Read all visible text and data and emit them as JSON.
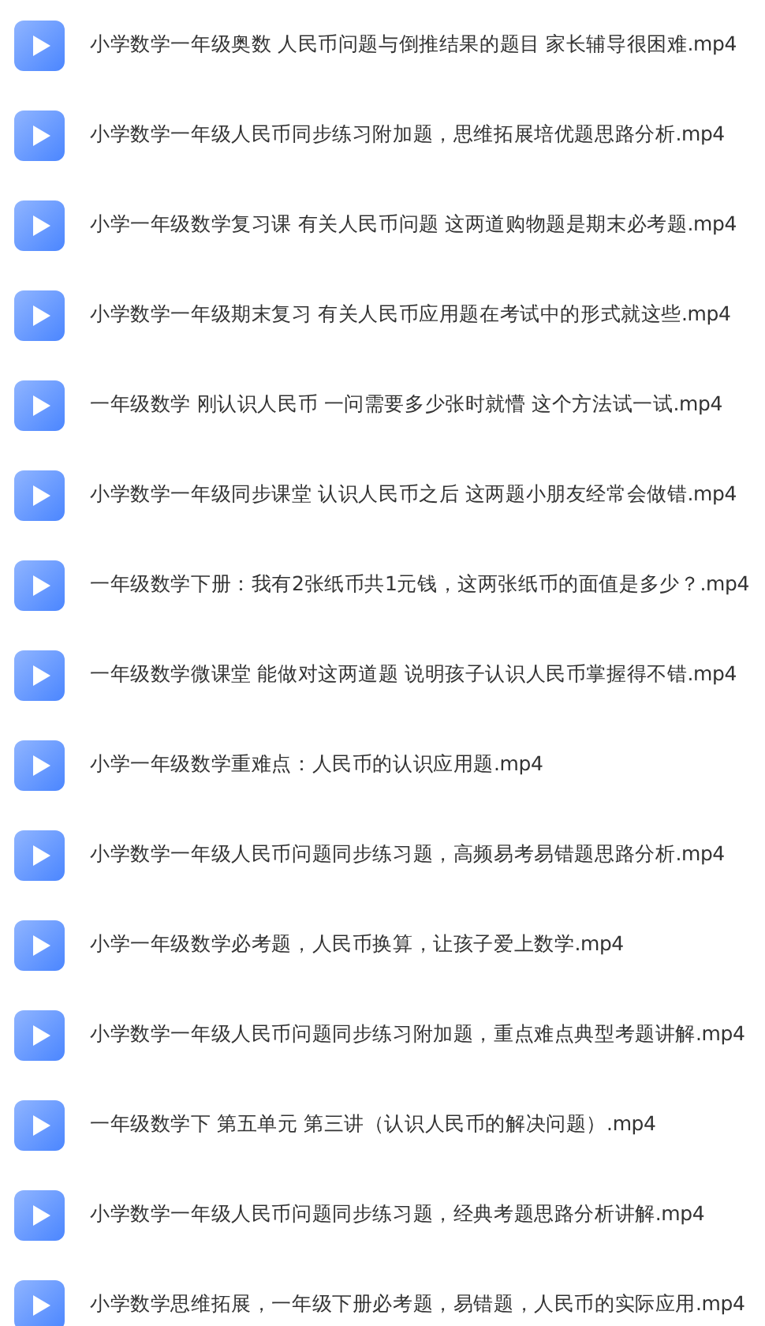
{
  "files": [
    {
      "name": "小学数学一年级奥数 人民币问题与倒推结果的题目 家长辅导很困难.mp4"
    },
    {
      "name": "小学数学一年级人民币同步练习附加题，思维拓展培优题思路分析.mp4"
    },
    {
      "name": "小学一年级数学复习课 有关人民币问题 这两道购物题是期末必考题.mp4"
    },
    {
      "name": "小学数学一年级期末复习 有关人民币应用题在考试中的形式就这些.mp4"
    },
    {
      "name": "一年级数学 刚认识人民币 一问需要多少张时就懵 这个方法试一试.mp4"
    },
    {
      "name": "小学数学一年级同步课堂 认识人民币之后 这两题小朋友经常会做错.mp4"
    },
    {
      "name": "一年级数学下册：我有2张纸币共1元钱，这两张纸币的面值是多少？.mp4"
    },
    {
      "name": "一年级数学微课堂 能做对这两道题 说明孩子认识人民币掌握得不错.mp4"
    },
    {
      "name": "小学一年级数学重难点：人民币的认识应用题.mp4"
    },
    {
      "name": "小学数学一年级人民币问题同步练习题，高频易考易错题思路分析.mp4"
    },
    {
      "name": "小学一年级数学必考题，人民币换算，让孩子爱上数学.mp4"
    },
    {
      "name": "小学数学一年级人民币问题同步练习附加题，重点难点典型考题讲解.mp4"
    },
    {
      "name": "一年级数学下 第五单元 第三讲（认识人民币的解决问题）.mp4"
    },
    {
      "name": "小学数学一年级人民币问题同步练习题，经典考题思路分析讲解.mp4"
    },
    {
      "name": "小学数学思维拓展，一年级下册必考题，易错题，人民币的实际应用.mp4"
    }
  ]
}
